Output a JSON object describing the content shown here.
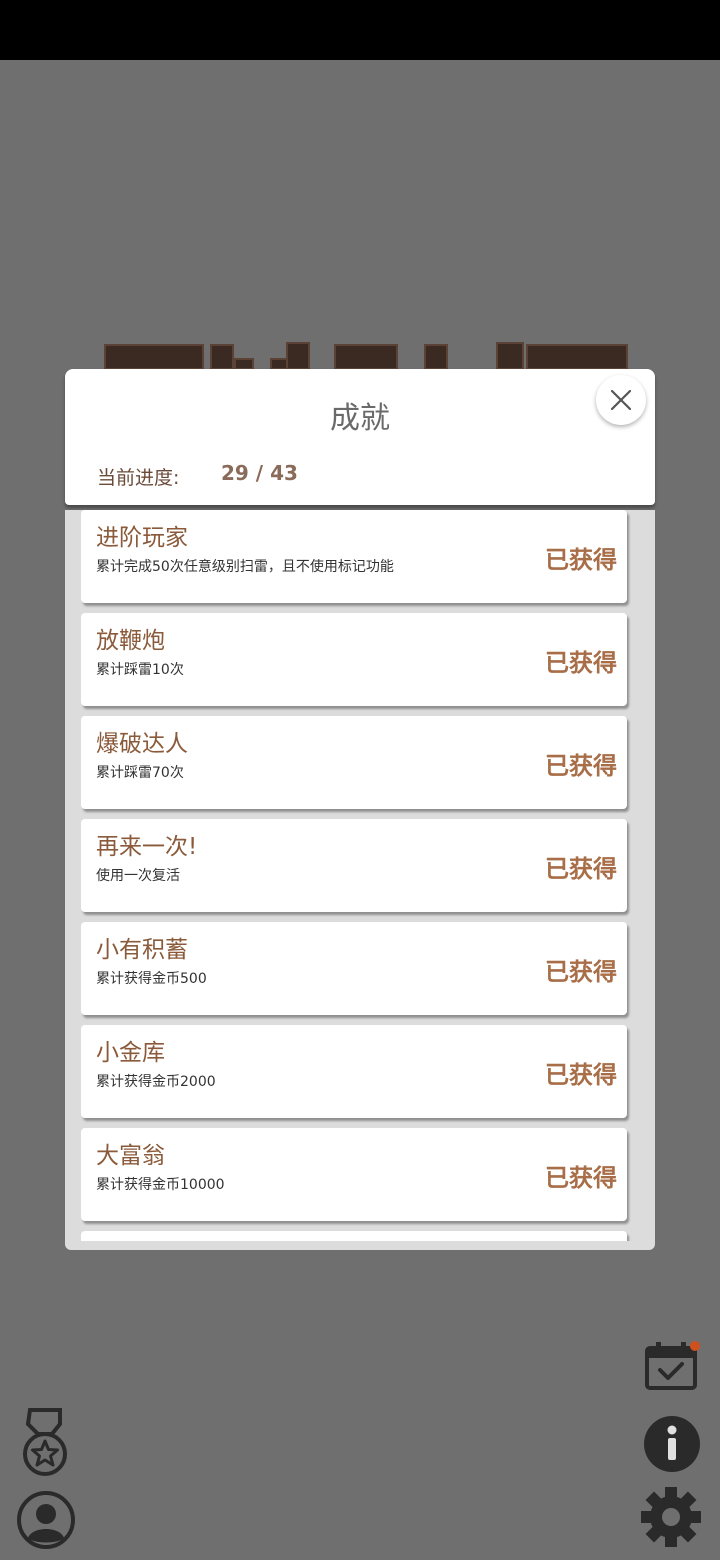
{
  "modal": {
    "title": "成就",
    "progress_label": "当前进度:",
    "progress_value": "29 / 43"
  },
  "achievements": [
    {
      "name": "进阶玩家",
      "desc": "累计完成50次任意级别扫雷，且不使用标记功能",
      "status": "已获得"
    },
    {
      "name": "放鞭炮",
      "desc": "累计踩雷10次",
      "status": "已获得"
    },
    {
      "name": "爆破达人",
      "desc": "累计踩雷70次",
      "status": "已获得"
    },
    {
      "name": "再来一次!",
      "desc": "使用一次复活",
      "status": "已获得"
    },
    {
      "name": "小有积蓄",
      "desc": "累计获得金币500",
      "status": "已获得"
    },
    {
      "name": "小金库",
      "desc": "累计获得金币2000",
      "status": "已获得"
    },
    {
      "name": "大富翁",
      "desc": "累计获得金币10000",
      "status": "已获得"
    }
  ],
  "icons": {
    "close": "close-icon",
    "medal": "medal-icon",
    "profile": "profile-icon",
    "calendar": "calendar-check-icon",
    "info": "info-icon",
    "settings": "gear-icon"
  },
  "colors": {
    "accent": "#a86e48",
    "name": "#8a5a3a",
    "background": "#6f6f6f",
    "notification_dot": "#d0501e"
  }
}
